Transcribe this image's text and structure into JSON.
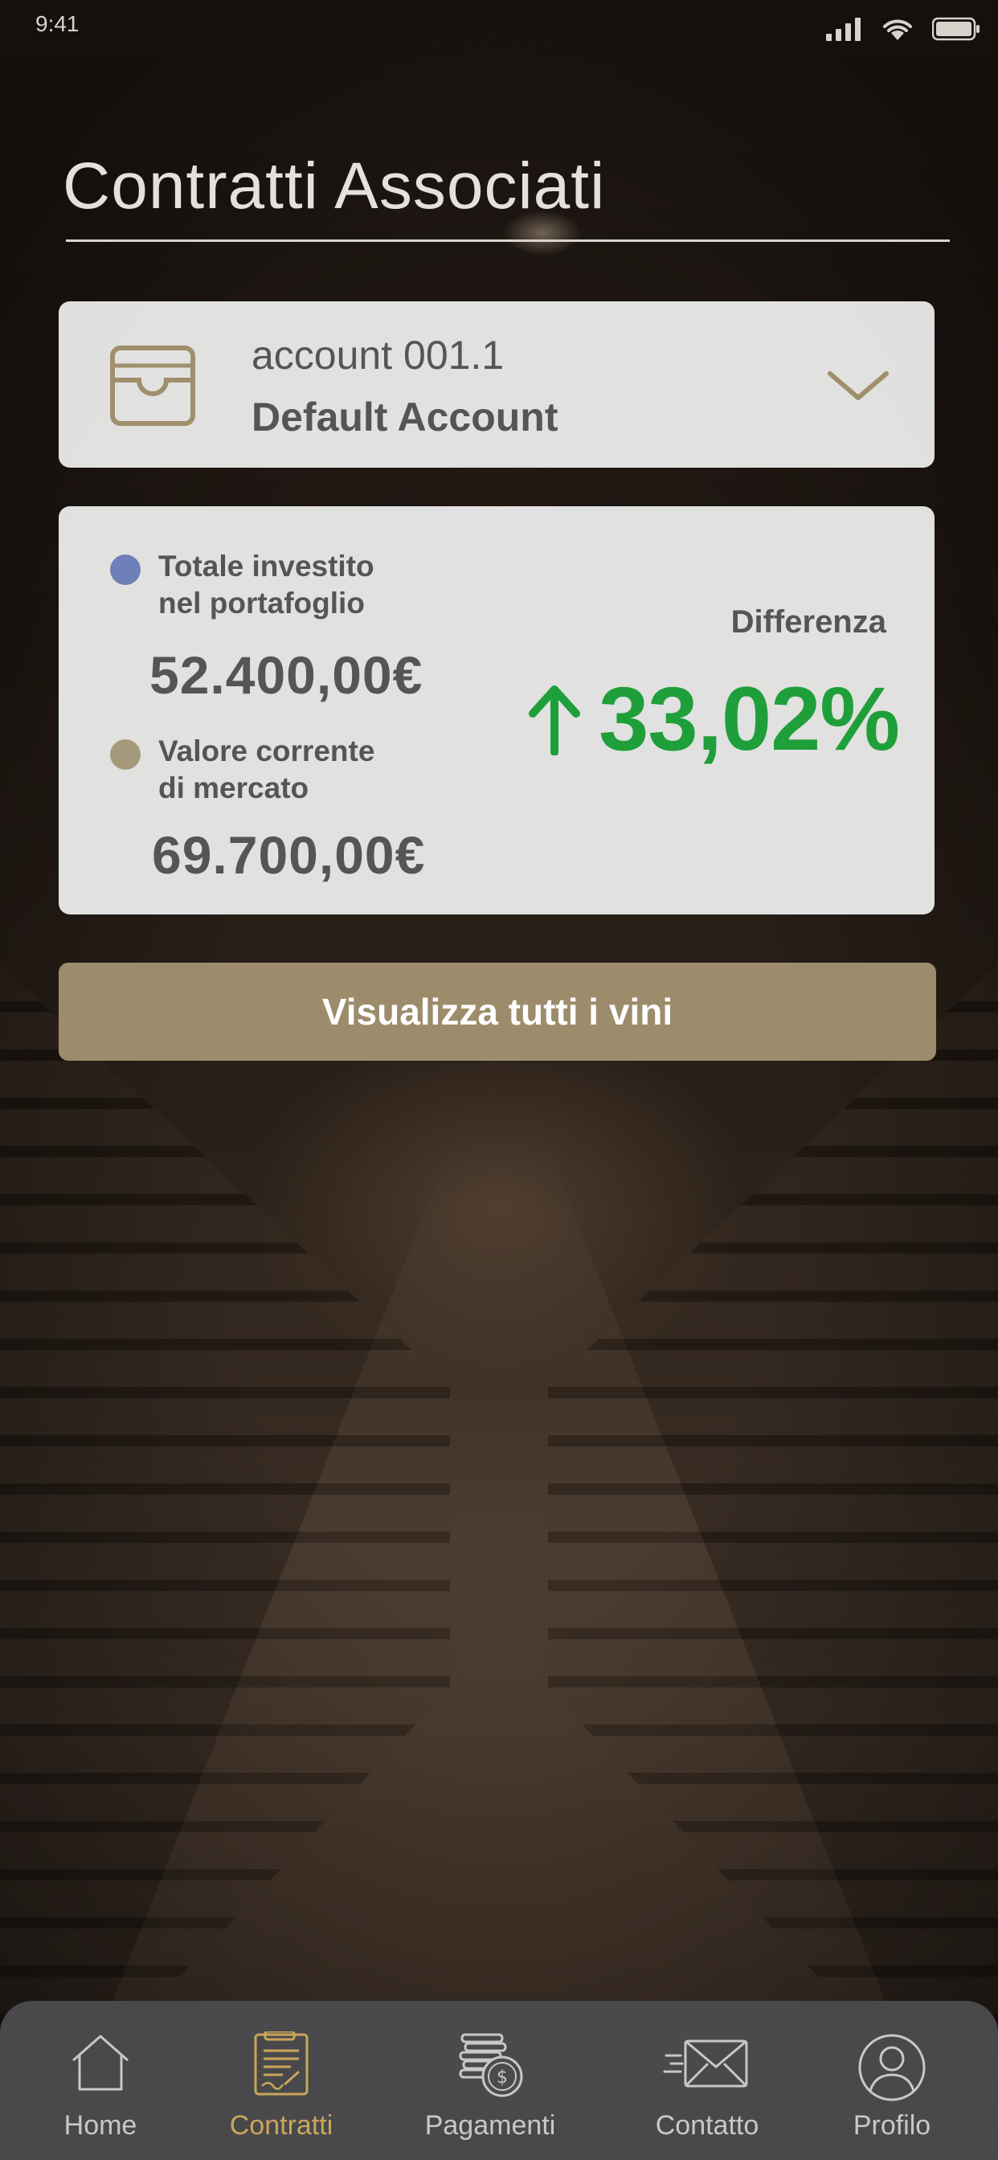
{
  "status_bar": {
    "time": "9:41",
    "icons": [
      "signal-icon",
      "wifi-icon",
      "battery-icon"
    ]
  },
  "header": {
    "title": "Contratti Associati"
  },
  "account_selector": {
    "icon": "wallet-icon",
    "account_name": "account 001.1",
    "account_type": "Default Account",
    "dropdown_icon": "chevron-down-icon"
  },
  "portfolio": {
    "invested": {
      "label_line1": "Totale investito",
      "label_line2": "nel portafoglio",
      "value": "52.400,00€",
      "dot_color": "#6f7fb8"
    },
    "market": {
      "label_line1": "Valore corrente",
      "label_line2": "di mercato",
      "value": "69.700,00€",
      "dot_color": "#a59a7c"
    },
    "difference": {
      "label": "Differenza",
      "value": "33,02%",
      "direction_icon": "arrow-up-icon",
      "color": "#1f9f3a"
    }
  },
  "actions": {
    "view_wines_label": "Visualizza tutti i vini",
    "button_color": "#9d8c6b"
  },
  "bottom_nav": {
    "items": [
      {
        "label": "Home",
        "icon": "home-icon",
        "active": false
      },
      {
        "label": "Contratti",
        "icon": "contract-icon",
        "active": true
      },
      {
        "label": "Pagamenti",
        "icon": "coins-icon",
        "active": false
      },
      {
        "label": "Contatto",
        "icon": "mail-icon",
        "active": false
      },
      {
        "label": "Profilo",
        "icon": "profile-icon",
        "active": false
      }
    ],
    "active_color": "#c9a659"
  }
}
